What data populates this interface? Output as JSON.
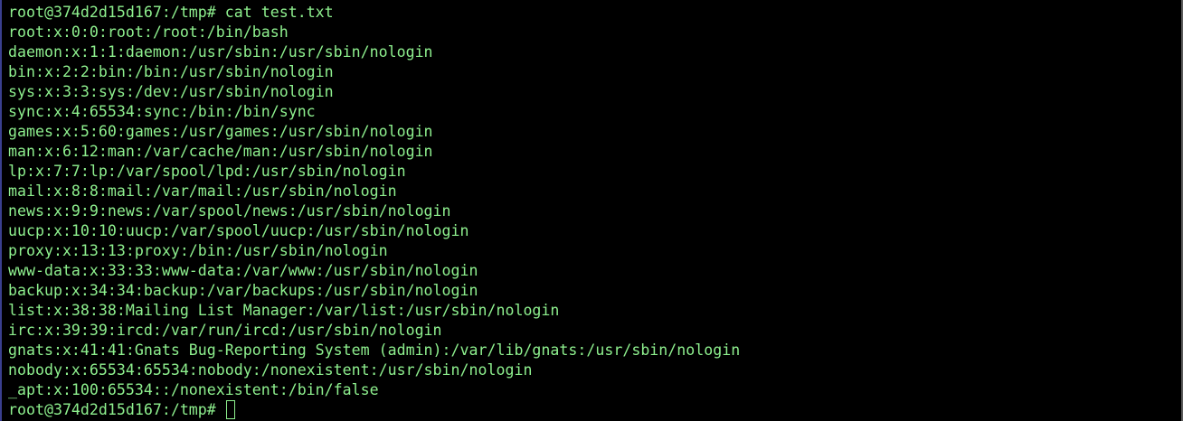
{
  "terminal": {
    "prompt": "root@374d2d15d167:/tmp#",
    "command": "cat test.txt",
    "output": [
      "root:x:0:0:root:/root:/bin/bash",
      "daemon:x:1:1:daemon:/usr/sbin:/usr/sbin/nologin",
      "bin:x:2:2:bin:/bin:/usr/sbin/nologin",
      "sys:x:3:3:sys:/dev:/usr/sbin/nologin",
      "sync:x:4:65534:sync:/bin:/bin/sync",
      "games:x:5:60:games:/usr/games:/usr/sbin/nologin",
      "man:x:6:12:man:/var/cache/man:/usr/sbin/nologin",
      "lp:x:7:7:lp:/var/spool/lpd:/usr/sbin/nologin",
      "mail:x:8:8:mail:/var/mail:/usr/sbin/nologin",
      "news:x:9:9:news:/var/spool/news:/usr/sbin/nologin",
      "uucp:x:10:10:uucp:/var/spool/uucp:/usr/sbin/nologin",
      "proxy:x:13:13:proxy:/bin:/usr/sbin/nologin",
      "www-data:x:33:33:www-data:/var/www:/usr/sbin/nologin",
      "backup:x:34:34:backup:/var/backups:/usr/sbin/nologin",
      "list:x:38:38:Mailing List Manager:/var/list:/usr/sbin/nologin",
      "irc:x:39:39:ircd:/var/run/ircd:/usr/sbin/nologin",
      "gnats:x:41:41:Gnats Bug-Reporting System (admin):/var/lib/gnats:/usr/sbin/nologin",
      "nobody:x:65534:65534:nobody:/nonexistent:/usr/sbin/nologin",
      "_apt:x:100:65534::/nonexistent:/bin/false"
    ],
    "final_prompt": "root@374d2d15d167:/tmp#",
    "colors": {
      "background": "#000000",
      "text": "#8ef08e",
      "left_border": "#3a3f8f"
    }
  }
}
